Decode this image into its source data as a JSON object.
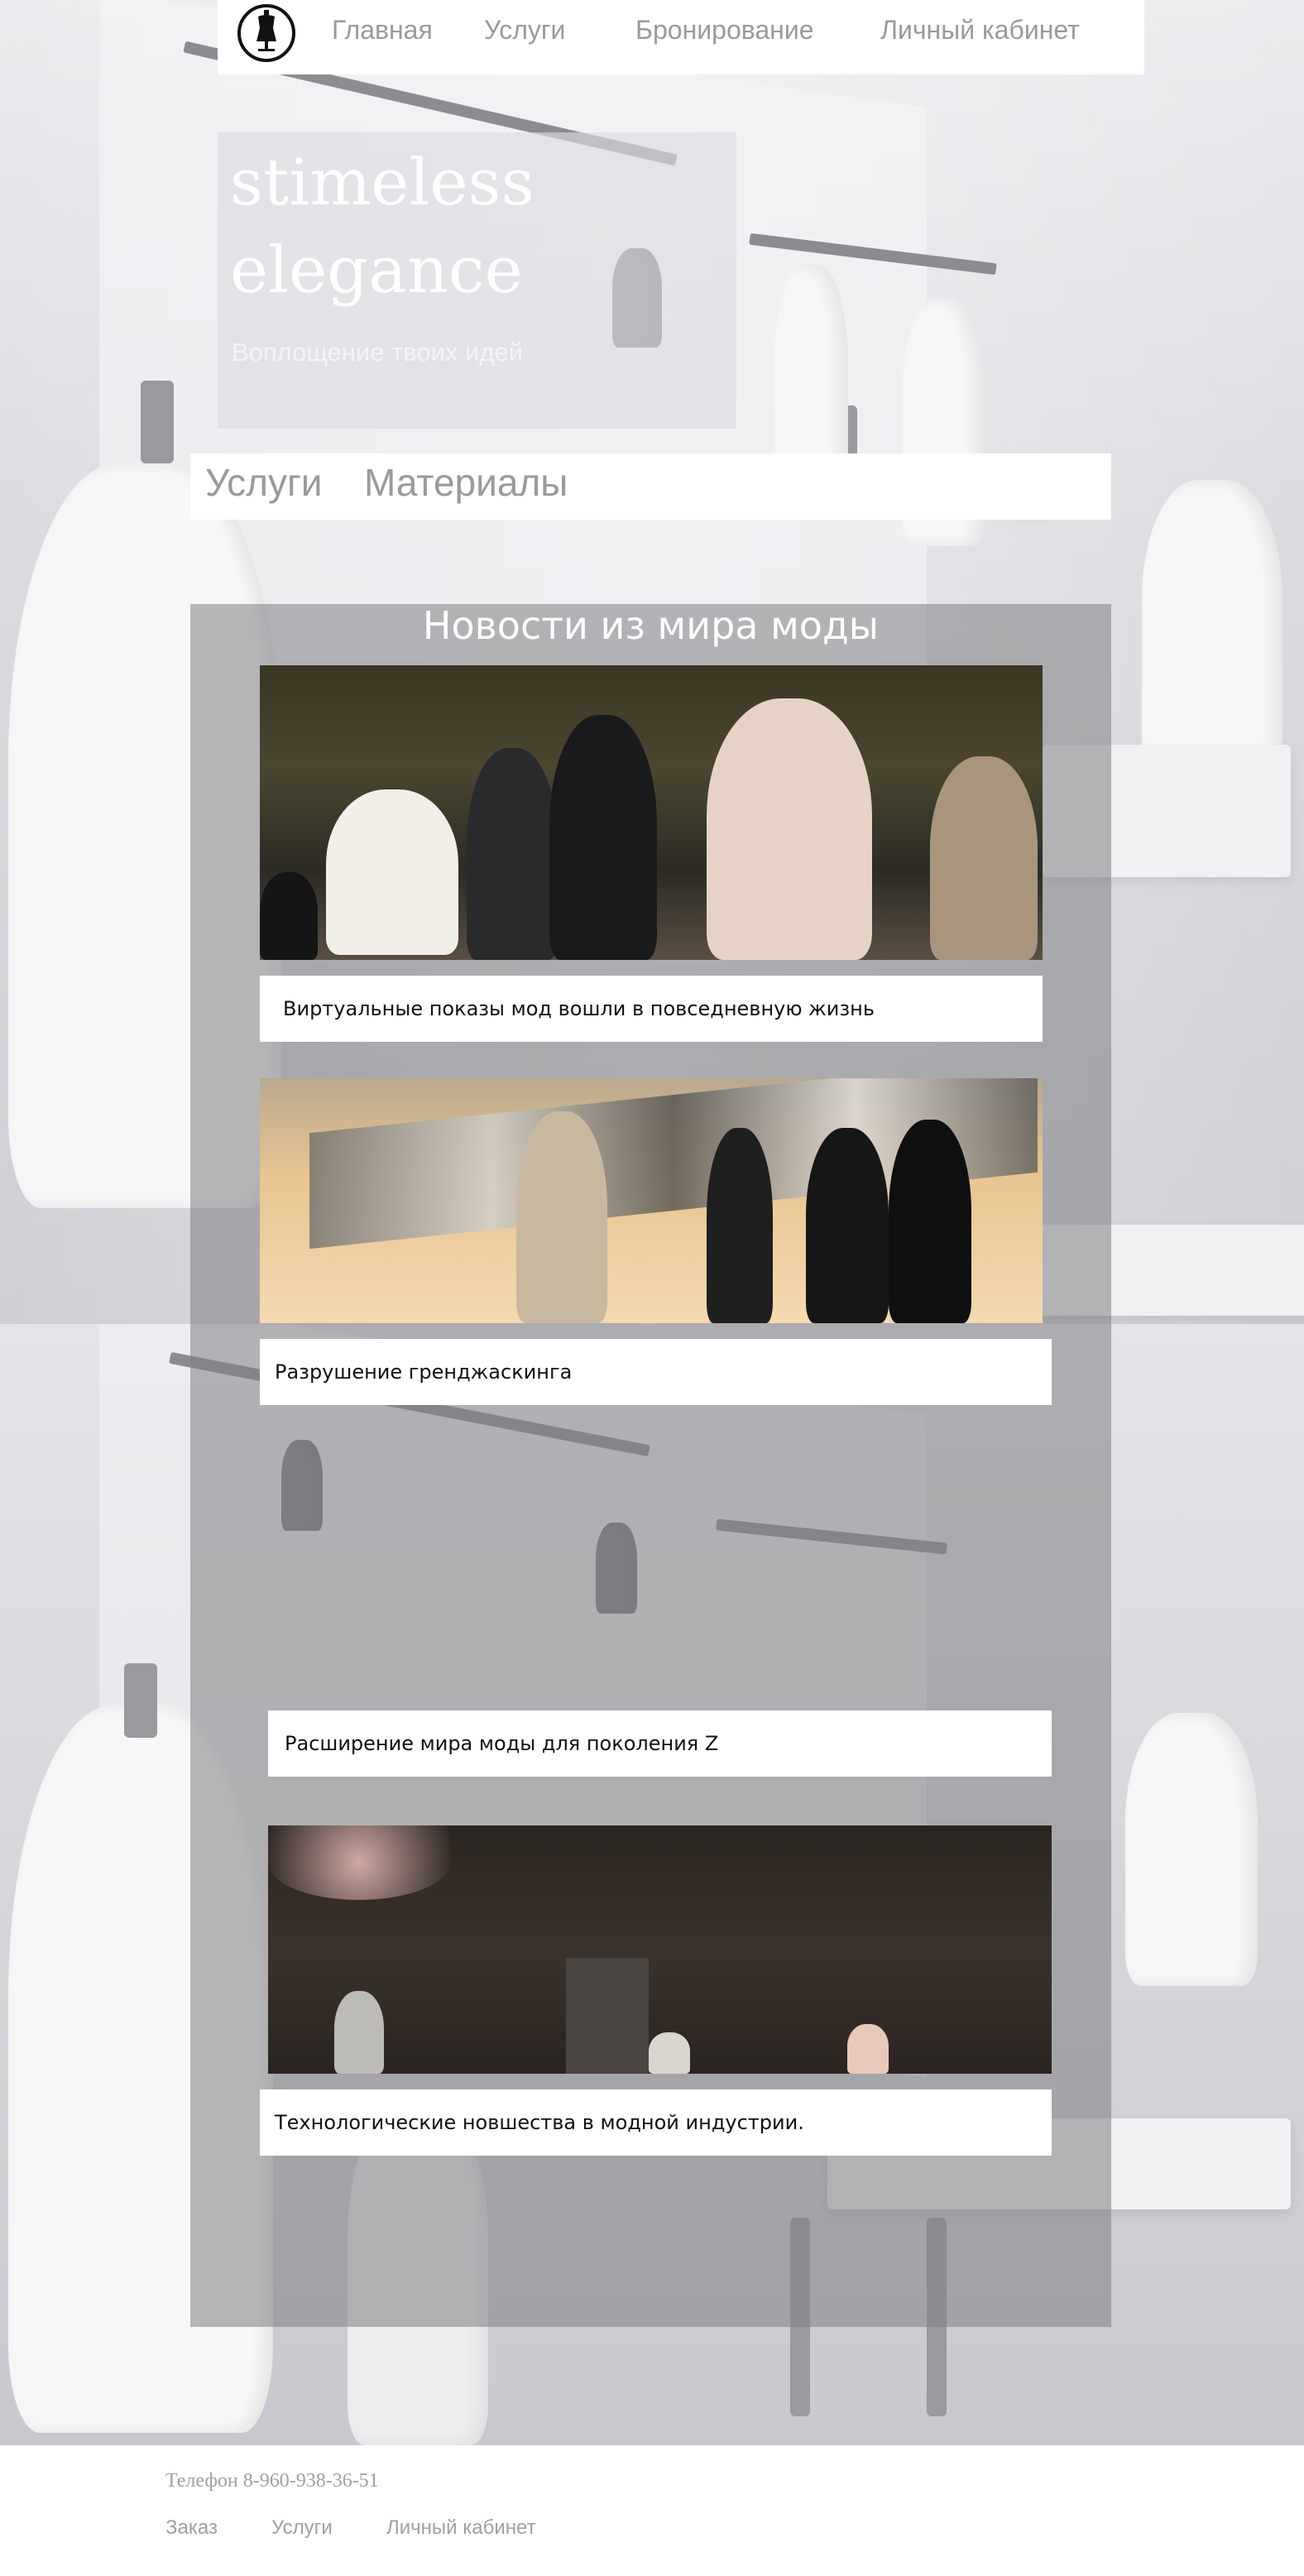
{
  "nav": {
    "logo_icon": "dress-form-icon",
    "links": [
      "Главная",
      "Услуги",
      "Бронирование",
      "Личный кабинет"
    ]
  },
  "hero": {
    "title": "stimeless elegance",
    "subtitle": "Воплощение твоих идей"
  },
  "tabs": [
    "Услуги",
    "Материалы"
  ],
  "news": {
    "title": "Новости из мира моды",
    "items": [
      {
        "caption": "Виртуальные показы мод вошли в повседневную жизнь",
        "has_image": true
      },
      {
        "caption": "Разрушение гренджаскинга",
        "has_image": true
      },
      {
        "caption": "Расширение мира моды для поколения Z",
        "has_image": false
      },
      {
        "caption": "Технологические новшества в модной индустрии.",
        "has_image": true
      }
    ]
  },
  "footer": {
    "phone": "Телефон 8-960-938-36-51",
    "links": [
      "Заказ",
      "Услуги",
      "Личный кабинет"
    ]
  },
  "colors": {
    "nav_bg": "#ffffff",
    "nav_text": "#9a9a9a",
    "panel_overlay": "#808084",
    "caption_bg": "#ffffff",
    "caption_text": "#111111"
  }
}
